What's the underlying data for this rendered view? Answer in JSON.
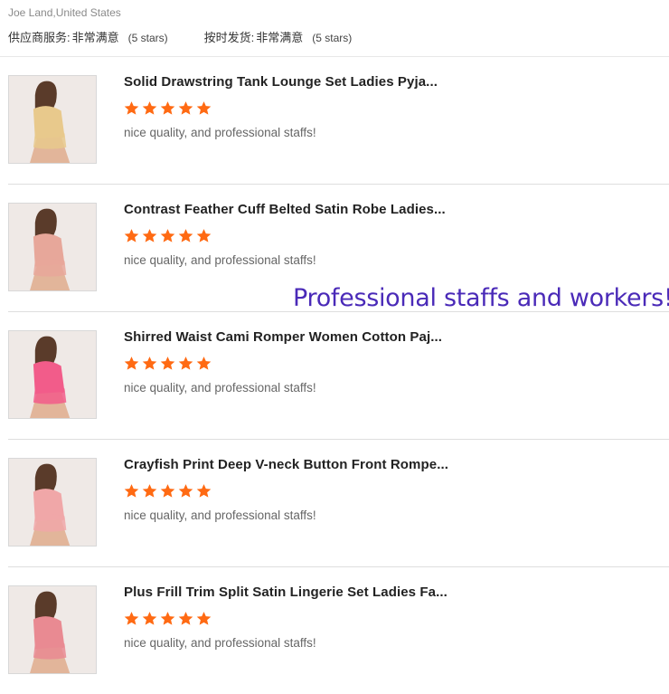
{
  "reviewer": {
    "name_location": "Joe Land,United States"
  },
  "ratings": [
    {
      "label": "供应商服务:",
      "value": "非常满意",
      "stars": "(5 stars)"
    },
    {
      "label": "按时发货:",
      "value": "非常满意",
      "stars": "(5 stars)"
    }
  ],
  "reviews": [
    {
      "title": "Solid Drawstring Tank Lounge Set Ladies Pyja...",
      "rating": 5,
      "comment": "nice quality, and professional staffs!",
      "thumb_color": "#e8c98c"
    },
    {
      "title": "Contrast Feather Cuff Belted Satin Robe Ladies...",
      "rating": 5,
      "comment": "nice quality, and professional staffs!",
      "thumb_color": "#e7a79a"
    },
    {
      "title": "Shirred Waist Cami Romper Women Cotton Paj...",
      "rating": 5,
      "comment": "nice quality, and professional staffs!",
      "thumb_color": "#f25c8a"
    },
    {
      "title": "Crayfish Print Deep V-neck Button Front Rompe...",
      "rating": 5,
      "comment": "nice quality, and professional staffs!",
      "thumb_color": "#f0a7a8"
    },
    {
      "title": "Plus Frill Trim Split Satin Lingerie Set Ladies Fa...",
      "rating": 5,
      "comment": "nice quality, and professional staffs!",
      "thumb_color": "#e98a92"
    }
  ],
  "overlay_text": "Professional staffs and workers!",
  "colors": {
    "star": "#ff6a13",
    "overlay": "#4a2ab8"
  }
}
